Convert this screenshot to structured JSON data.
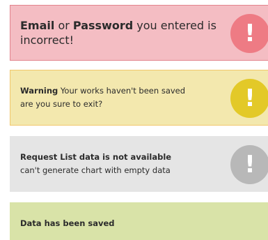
{
  "alerts": {
    "error": {
      "part1": "Email",
      "part2": " or ",
      "part3": "Password",
      "part4": " you entered is incorrect!",
      "icon": "exclamation-icon",
      "icon_glyph": "!",
      "colors": {
        "background": "#f4bdc3",
        "border": "#e2848d",
        "icon": "#ee7b84"
      }
    },
    "warning": {
      "title": "Warning",
      "text1": " Your works haven't been saved",
      "text2": "are you sure to exit?",
      "icon": "exclamation-icon",
      "icon_glyph": "!",
      "colors": {
        "background": "#f3e8ae",
        "border": "#f1c76b",
        "icon": "#e3c928"
      }
    },
    "info": {
      "title": "Request List data is not available",
      "text": "can't generate chart with empty data",
      "icon": "exclamation-icon",
      "icon_glyph": "!",
      "colors": {
        "background": "#e5e5e5",
        "icon": "#b8b8b8"
      }
    },
    "success": {
      "title": "Data has been saved",
      "colors": {
        "background": "#d9e3a8"
      }
    }
  }
}
